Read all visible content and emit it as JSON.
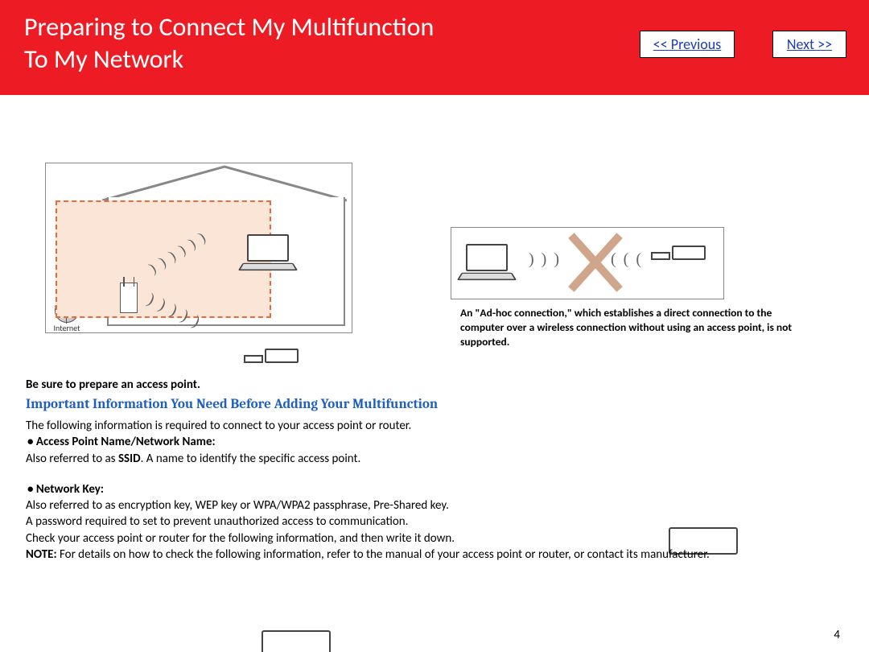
{
  "header": {
    "title_line1": "Preparing to Connect My Multifunction",
    "title_line2": "To My Network",
    "prev": "<< Previous",
    "next": "Next >>"
  },
  "diagram_left": {
    "internet_label": "Internet"
  },
  "caption": "An \"Ad-hoc connection,\" which establishes a direct connection to the computer over a wireless connection without using an access point, is not supported.",
  "body": {
    "prepare": "Be sure to prepare an access point.",
    "subhead": "Important Information You Need Before Adding Your Multifunction",
    "intro": "The following information is required to connect to your access point or router.",
    "ap_label": "Access Point Name/Network Name:",
    "ap_desc_pre": "Also referred to as ",
    "ap_desc_bold": "SSID",
    "ap_desc_post": ". A name to identify the specific access point.",
    "key_label": "Network Key:",
    "key_l1": "Also referred to as encryption key, WEP key or WPA/WPA2 passphrase, Pre-Shared key.",
    "key_l2": "A password required to set to prevent unauthorized access to communication.",
    "key_l3": "Check your access point or router for the following information, and then write it down.",
    "note_bold": "NOTE:",
    "note": "  For details on how to check the following information, refer to the manual of your access point or router, or contact its manufacturer."
  },
  "page_number": "4"
}
